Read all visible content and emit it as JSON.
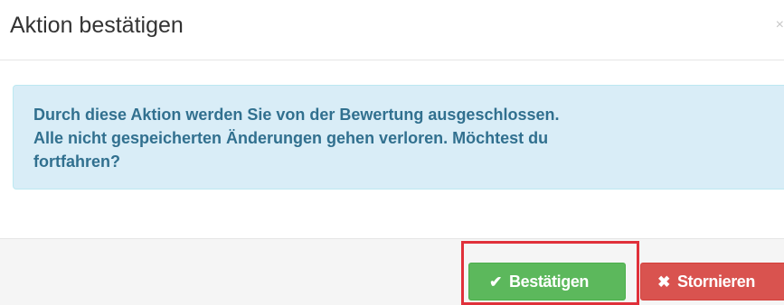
{
  "dialog": {
    "title": "Aktion bestätigen",
    "close_glyph": "×"
  },
  "alert": {
    "lines": [
      "Durch diese Aktion werden Sie von der Bewertung ausgeschlossen.",
      "Alle nicht gespeicherten Änderungen gehen verloren. Möchtest du",
      "fortfahren?"
    ],
    "background_color": "#d9edf7",
    "text_color": "#31708f"
  },
  "footer": {
    "confirm_label": "Bestätigen",
    "confirm_icon": "check-icon",
    "confirm_glyph": "✔",
    "cancel_label": "Stornieren",
    "cancel_icon": "x-icon",
    "cancel_glyph": "✖",
    "confirm_color": "#5cb85c",
    "cancel_color": "#d9534f"
  },
  "highlight": {
    "target": "confirm-button",
    "color": "#e0303a"
  }
}
